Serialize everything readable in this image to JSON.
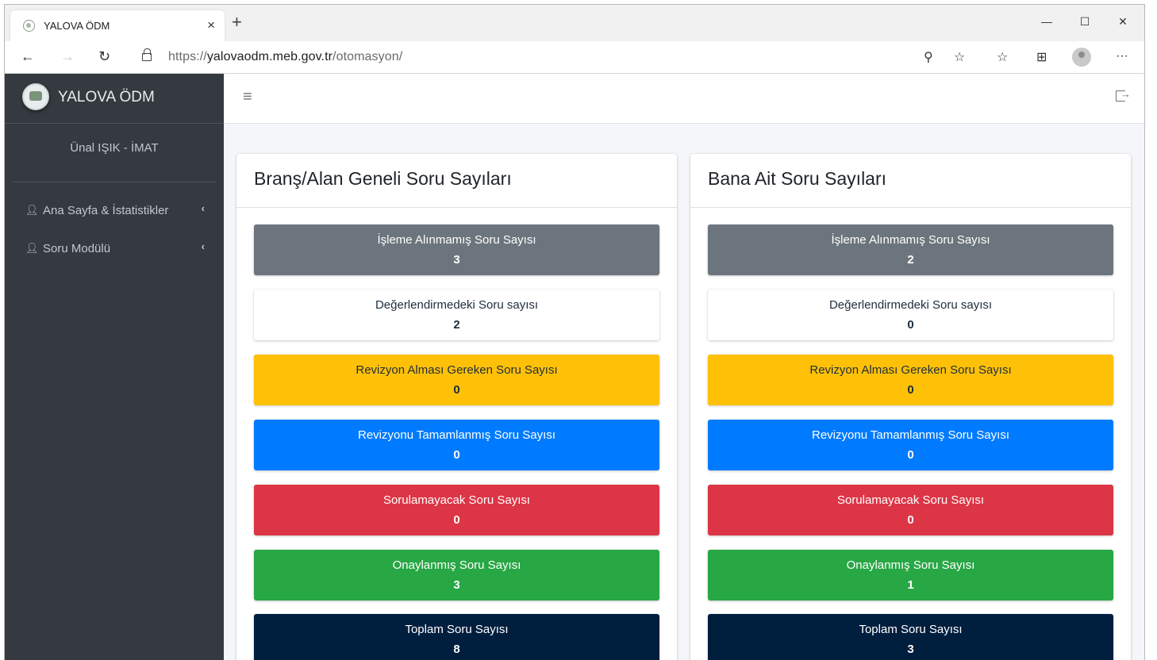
{
  "browser": {
    "tab_title": "YALOVA ÖDM",
    "close_tab": "×",
    "new_tab": "+",
    "minimize": "—",
    "maximize": "☐",
    "close_window": "✕",
    "url_prefix": "https://",
    "url_host": "yalovaodm.meb.gov.tr",
    "url_path": "/otomasyon/",
    "back": "←",
    "forward": "→",
    "refresh": "↻",
    "search_key": "⚲",
    "favorite": "☆",
    "favorites_list": "☆",
    "collections": "⊞",
    "more": "···"
  },
  "sidebar": {
    "brand": "YALOVA ÖDM",
    "user": "Ünal IŞIK - İMAT",
    "items": [
      {
        "label": "Ana Sayfa & İstatistikler",
        "icon": "user-question-icon",
        "caret": "‹"
      },
      {
        "label": "Soru Modülü",
        "icon": "user-question-icon",
        "caret": "‹"
      }
    ]
  },
  "topnav": {
    "menu_toggle": "≡"
  },
  "cards": [
    {
      "title": "Branş/Alan Geneli Soru Sayıları",
      "stats": [
        {
          "label": "İşleme Alınmamış Soru Sayısı",
          "value": "3"
        },
        {
          "label": "Değerlendirmedeki Soru sayısı",
          "value": "2"
        },
        {
          "label": "Revizyon Alması Gereken Soru Sayısı",
          "value": "0"
        },
        {
          "label": "Revizyonu Tamamlanmış Soru Sayısı",
          "value": "0"
        },
        {
          "label": "Sorulamayacak Soru Sayısı",
          "value": "0"
        },
        {
          "label": "Onaylanmış Soru Sayısı",
          "value": "3"
        },
        {
          "label": "Toplam Soru Sayısı",
          "value": "8"
        }
      ]
    },
    {
      "title": "Bana Ait Soru Sayıları",
      "stats": [
        {
          "label": "İşleme Alınmamış Soru Sayısı",
          "value": "2"
        },
        {
          "label": "Değerlendirmedeki Soru sayısı",
          "value": "0"
        },
        {
          "label": "Revizyon Alması Gereken Soru Sayısı",
          "value": "0"
        },
        {
          "label": "Revizyonu Tamamlanmış Soru Sayısı",
          "value": "0"
        },
        {
          "label": "Sorulamayacak Soru Sayısı",
          "value": "0"
        },
        {
          "label": "Onaylanmış Soru Sayısı",
          "value": "1"
        },
        {
          "label": "Toplam Soru Sayısı",
          "value": "3"
        }
      ]
    }
  ],
  "colors": {
    "secondary": "#6c757d",
    "light": "#ffffff",
    "warning": "#ffc107",
    "primary": "#007bff",
    "danger": "#dc3545",
    "success": "#28a745",
    "navy": "#001f3f",
    "sidebar": "#343a40"
  }
}
